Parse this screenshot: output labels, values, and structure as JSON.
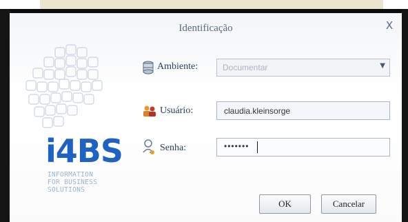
{
  "dialog": {
    "title": "Identificação",
    "close_label": "X"
  },
  "logo": {
    "brand": "i4BS",
    "tagline_lines": [
      "INFORMATION",
      "FOR BUSINESS",
      "SOLUTIONS"
    ]
  },
  "form": {
    "ambiente": {
      "label": "Ambiente:",
      "value": "Documentar",
      "icon": "database-icon"
    },
    "usuario": {
      "label": "Usuário:",
      "value": "claudia.kleinsorge",
      "icon": "users-icon"
    },
    "senha": {
      "label": "Senha:",
      "value": "•••••••",
      "icon": "user-key-icon"
    }
  },
  "buttons": {
    "ok_label": "OK",
    "cancel_label": "Cancelar"
  },
  "colors": {
    "brand_blue": "#1f63c2",
    "title_text": "#5a6a86",
    "label_text": "#2c3d5a"
  }
}
